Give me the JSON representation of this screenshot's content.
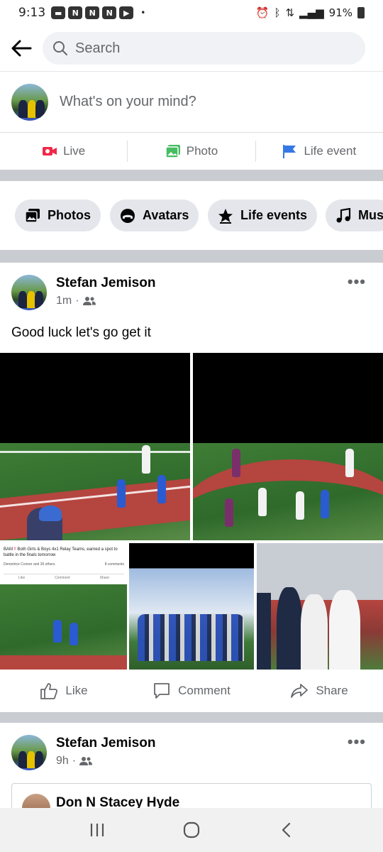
{
  "status_bar": {
    "time": "9:13",
    "notification_icons": [
      "messages-icon",
      "news-icon",
      "news-icon",
      "news-icon",
      "youtube-icon"
    ],
    "dot": "•",
    "battery": "91%"
  },
  "search": {
    "placeholder": "Search"
  },
  "composer": {
    "prompt": "What's on your mind?"
  },
  "composer_actions": [
    {
      "label": "Live",
      "icon": "live-video-icon",
      "color": "#f02849"
    },
    {
      "label": "Photo",
      "icon": "photo-icon",
      "color": "#45bd62"
    },
    {
      "label": "Life event",
      "icon": "flag-icon",
      "color": "#3578e5"
    }
  ],
  "chips": [
    {
      "label": "Photos",
      "icon": "photos-icon"
    },
    {
      "label": "Avatars",
      "icon": "avatar-icon"
    },
    {
      "label": "Life events",
      "icon": "star-icon"
    },
    {
      "label": "Mus",
      "icon": "music-icon"
    }
  ],
  "post": {
    "author": "Stefan Jemison",
    "time": "1m",
    "separator": "·",
    "audience_icon": "friends-icon",
    "text": "Good luck let's go get it",
    "more": "•••",
    "screenshot_tile": {
      "headline_prefix": "BAM",
      "headline_mark": "‼",
      "headline": "Both Girls & Boys 4x1 Relay Teams, earned a spot to battle in the finals tomorrow",
      "reactions": "Demetrice Conner and 26 others",
      "comments": "8 comments",
      "like": "Like",
      "comment": "Comment",
      "share": "Share"
    }
  },
  "reactions": [
    {
      "label": "Like",
      "icon": "like-icon"
    },
    {
      "label": "Comment",
      "icon": "comment-icon"
    },
    {
      "label": "Share",
      "icon": "share-icon"
    }
  ],
  "post2": {
    "author": "Stefan Jemison",
    "time": "9h",
    "separator": "·",
    "audience_icon": "friends-icon",
    "more": "•••",
    "shared_name": "Don N Stacey Hyde"
  },
  "nav": [
    "recents-icon",
    "home-icon",
    "back-icon"
  ],
  "colors": {
    "facebook_blue": "#1877f2",
    "secondary_text": "#65676b",
    "divider": "#c9ccd1"
  }
}
